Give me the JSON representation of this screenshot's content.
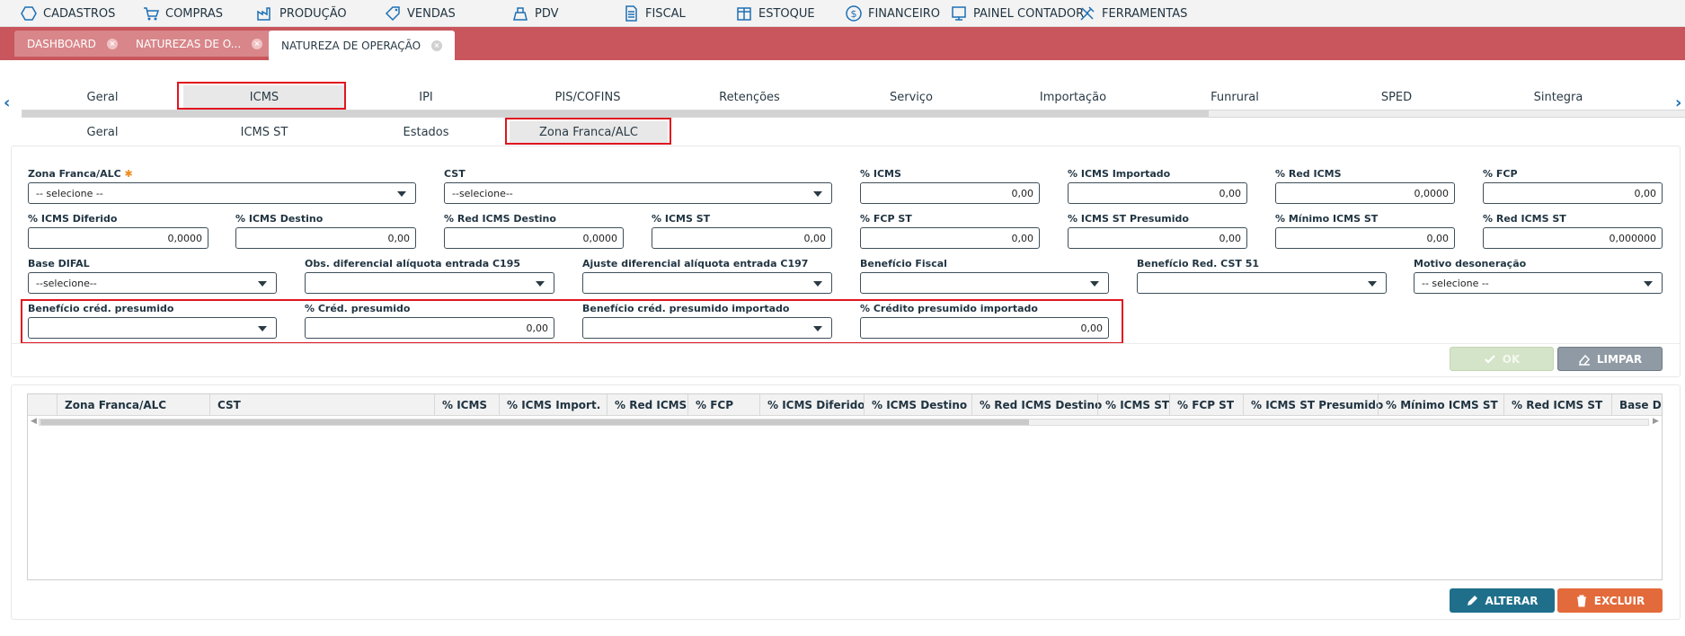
{
  "menu": [
    {
      "label": "CADASTROS",
      "icon": "hexagon-icon"
    },
    {
      "label": "COMPRAS",
      "icon": "cart-icon"
    },
    {
      "label": "PRODUÇÃO",
      "icon": "factory-icon"
    },
    {
      "label": "VENDAS",
      "icon": "tag-icon"
    },
    {
      "label": "PDV",
      "icon": "register-icon"
    },
    {
      "label": "FISCAL",
      "icon": "document-icon"
    },
    {
      "label": "ESTOQUE",
      "icon": "box-icon"
    },
    {
      "label": "FINANCEIRO",
      "icon": "dollar-icon"
    },
    {
      "label": "PAINEL CONTADOR",
      "icon": "panel-icon"
    },
    {
      "label": "FERRAMENTAS",
      "icon": "tools-icon"
    }
  ],
  "doc_tabs": [
    {
      "label": "DASHBOARD"
    },
    {
      "label": "NATUREZAS DE O..."
    },
    {
      "label": "NATUREZA DE OPERAÇÃO"
    }
  ],
  "tabs_main": [
    "Geral",
    "ICMS",
    "IPI",
    "PIS/COFINS",
    "Retenções",
    "Serviço",
    "Importação",
    "Funrural",
    "SPED",
    "Sintegra"
  ],
  "tabs_sub": [
    "Geral",
    "ICMS ST",
    "Estados",
    "Zona Franca/ALC"
  ],
  "form": {
    "zona_franca": {
      "label": "Zona Franca/ALC",
      "required_mark": "✱",
      "value": "-- selecione --"
    },
    "cst": {
      "label": "CST",
      "value": "--selecione--"
    },
    "icms": {
      "label": "% ICMS",
      "value": "0,00"
    },
    "icms_importado": {
      "label": "% ICMS Importado",
      "value": "0,00"
    },
    "red_icms": {
      "label": "% Red ICMS",
      "value": "0,0000"
    },
    "fcp": {
      "label": "% FCP",
      "value": "0,00"
    },
    "icms_diferido": {
      "label": "% ICMS Diferido",
      "value": "0,0000"
    },
    "icms_destino": {
      "label": "% ICMS Destino",
      "value": "0,00"
    },
    "red_icms_destino": {
      "label": "% Red ICMS Destino",
      "value": "0,0000"
    },
    "icms_st": {
      "label": "% ICMS ST",
      "value": "0,00"
    },
    "fcp_st": {
      "label": "% FCP ST",
      "value": "0,00"
    },
    "icms_st_presumido": {
      "label": "% ICMS ST Presumido",
      "value": "0,00"
    },
    "minimo_icms_st": {
      "label": "% Mínimo ICMS ST",
      "value": "0,00"
    },
    "red_icms_st": {
      "label": "% Red ICMS ST",
      "value": "0,000000"
    },
    "base_difal": {
      "label": "Base DIFAL",
      "value": "--selecione--"
    },
    "obs_c195": {
      "label": "Obs. diferencial alíquota entrada C195",
      "value": ""
    },
    "ajuste_c197": {
      "label": "Ajuste diferencial alíquota entrada C197",
      "value": ""
    },
    "beneficio_fiscal": {
      "label": "Benefício Fiscal",
      "value": ""
    },
    "beneficio_red_cst51": {
      "label": "Benefício Red. CST 51",
      "value": ""
    },
    "motivo_desoneracao": {
      "label": "Motivo desoneração",
      "value": "-- selecione --"
    },
    "beneficio_cred_presumido": {
      "label": "Benefício créd. presumido",
      "value": ""
    },
    "cred_presumido": {
      "label": "% Créd. presumido",
      "value": "0,00"
    },
    "beneficio_cred_presumido_importado": {
      "label": "Benefício créd. presumido importado",
      "value": ""
    },
    "credito_presumido_importado": {
      "label": "% Crédito presumido importado",
      "value": "0,00"
    }
  },
  "buttons": {
    "ok": "OK",
    "limpar": "LIMPAR",
    "alterar": "ALTERAR",
    "excluir": "EXCLUIR"
  },
  "grid_columns": [
    "Zona Franca/ALC",
    "CST",
    "% ICMS",
    "% ICMS Import.",
    "% Red ICMS",
    "% FCP",
    "% ICMS Diferido",
    "% ICMS Destino",
    "% Red ICMS Destino",
    "% ICMS ST",
    "% FCP ST",
    "% ICMS ST Presumido",
    "% Mínimo ICMS ST",
    "% Red ICMS ST",
    "Base D"
  ],
  "colors": {
    "tabbar": "#c8565c",
    "highlight": "#e0151f",
    "alterar": "#1f6f8b",
    "excluir": "#e36a3a"
  }
}
